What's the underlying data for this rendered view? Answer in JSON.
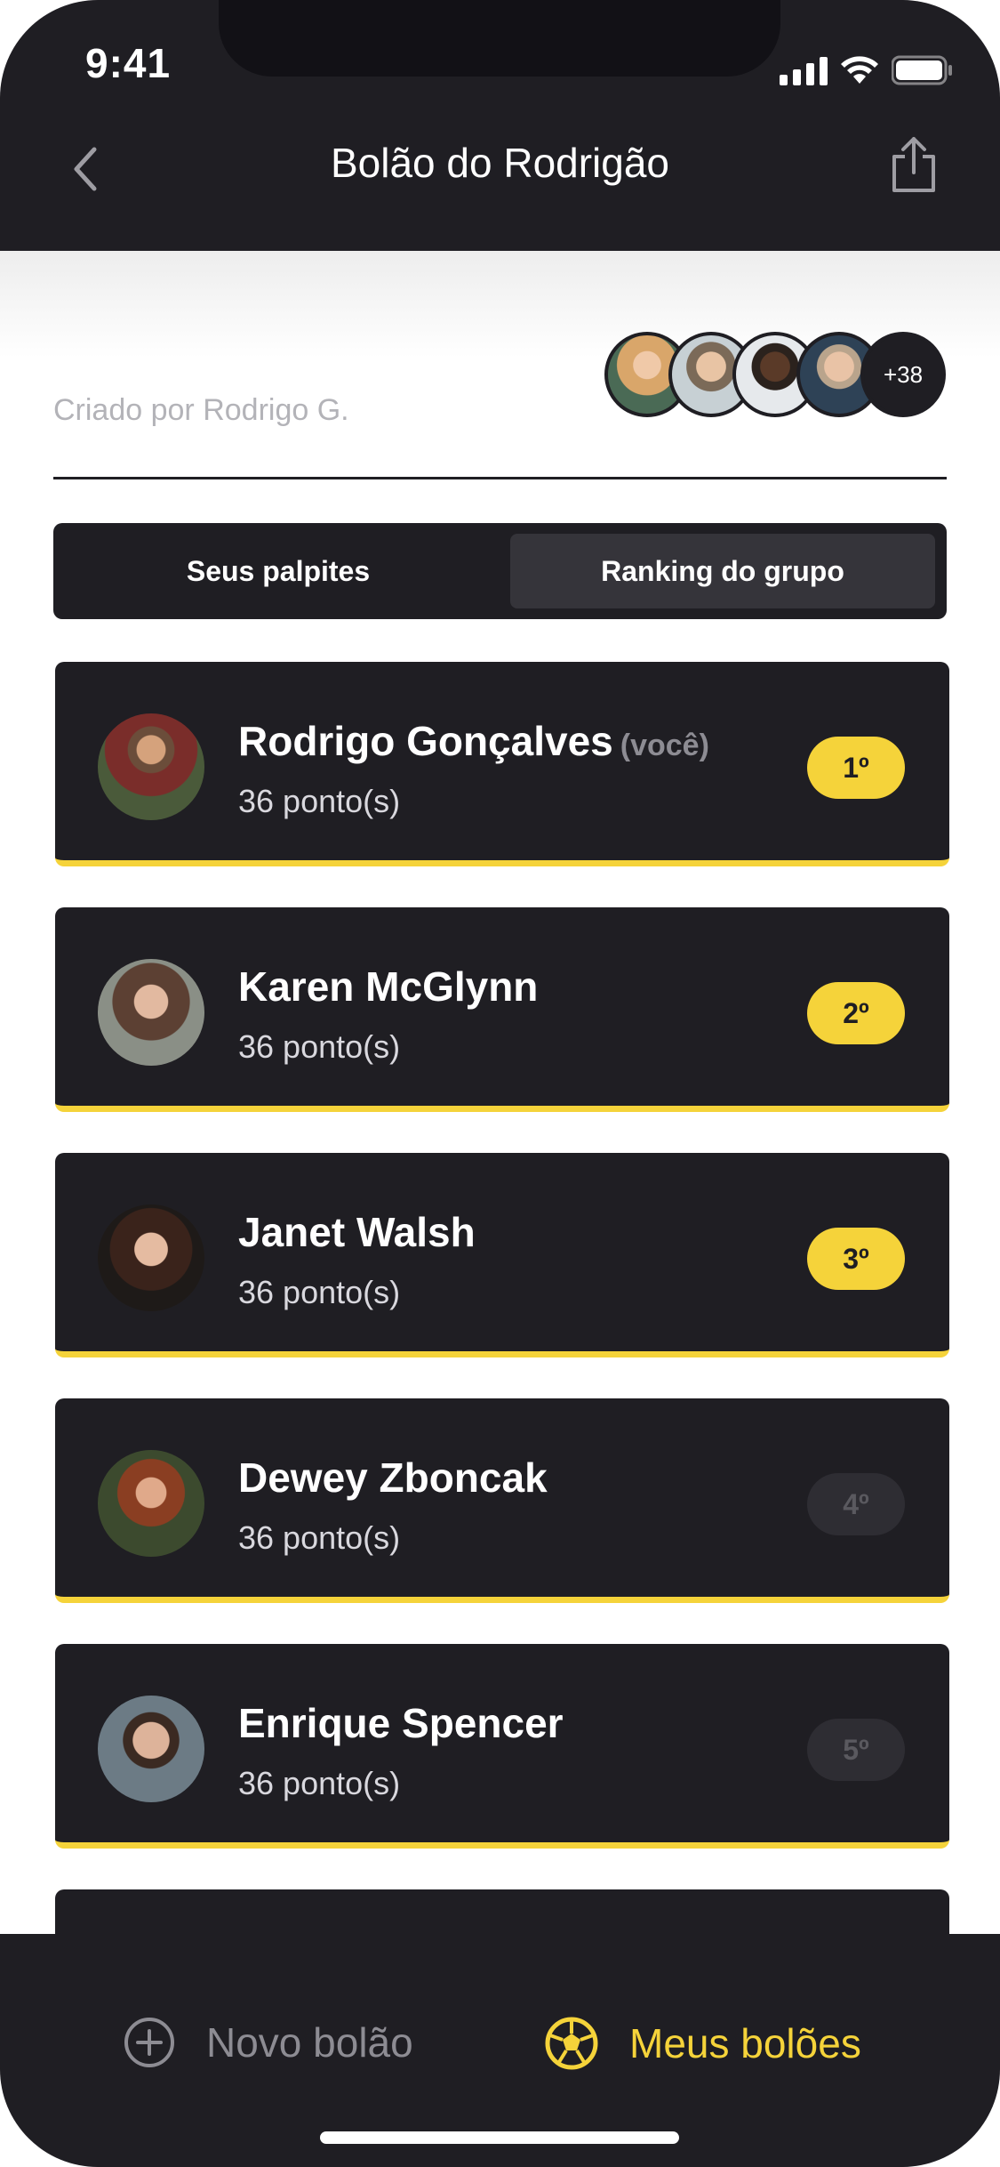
{
  "status_bar": {
    "time": "9:41"
  },
  "header": {
    "title": "Bolão do Rodrigão"
  },
  "group": {
    "created_by": "Criado por Rodrigo G.",
    "more_members": "+38"
  },
  "segments": {
    "left": "Seus palpites",
    "right": "Ranking do grupo",
    "selected": "right"
  },
  "ranking": [
    {
      "name": "Rodrigo Gonçalves",
      "you": "(você)",
      "points": "36 ponto(s)",
      "position": "1º",
      "highlight": true
    },
    {
      "name": "Karen McGlynn",
      "you": "",
      "points": "36 ponto(s)",
      "position": "2º",
      "highlight": true
    },
    {
      "name": "Janet Walsh",
      "you": "",
      "points": "36 ponto(s)",
      "position": "3º",
      "highlight": true
    },
    {
      "name": "Dewey Zboncak",
      "you": "",
      "points": "36 ponto(s)",
      "position": "4º",
      "highlight": false
    },
    {
      "name": "Enrique Spencer",
      "you": "",
      "points": "36 ponto(s)",
      "position": "5º",
      "highlight": false
    }
  ],
  "tabbar": {
    "new_label": "Novo bolão",
    "mine_label": "Meus bolões"
  },
  "colors": {
    "dark": "#1f1e23",
    "accent": "#f5d33a",
    "muted": "#8d8c93"
  }
}
